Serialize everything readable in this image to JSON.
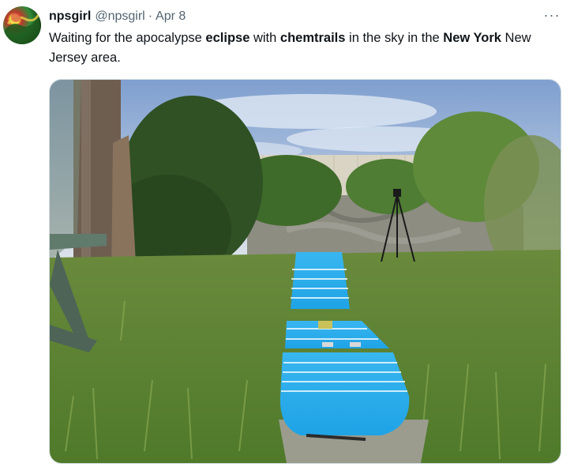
{
  "tweet": {
    "display_name": "npsgirl",
    "handle": "@npsgirl",
    "separator": "·",
    "date": "Apr 8",
    "more_label": "···",
    "text_segments": [
      {
        "text": "Waiting for the apocalypse ",
        "bold": false
      },
      {
        "text": "eclipse",
        "bold": true
      },
      {
        "text": " with ",
        "bold": false
      },
      {
        "text": "chemtrails",
        "bold": true
      },
      {
        "text": " in the sky in the ",
        "bold": false
      },
      {
        "text": "New York",
        "bold": true
      },
      {
        "text": " New Jersey area.",
        "bold": false
      }
    ]
  },
  "icons": {
    "more": "more-horizontal-icon",
    "avatar": "profile-avatar"
  },
  "colors": {
    "text_primary": "#0f1419",
    "text_secondary": "#536471",
    "border": "#cfd9de"
  }
}
